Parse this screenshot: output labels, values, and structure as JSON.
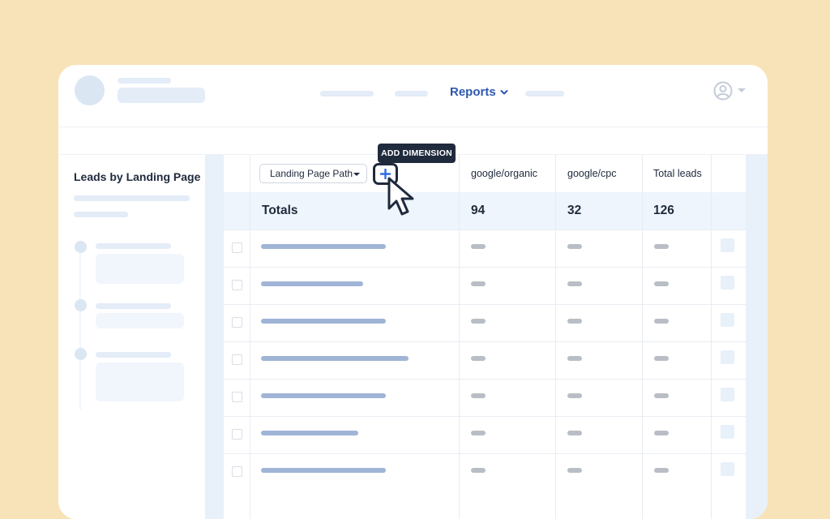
{
  "header": {
    "nav_active": "Reports"
  },
  "sidebar": {
    "title": "Leads by Landing Page"
  },
  "table": {
    "dimension_select": "Landing Page Path",
    "add_dimension_tooltip": "ADD DIMENSION",
    "columns": [
      "google/organic",
      "google/cpc",
      "Total leads"
    ],
    "totals_label": "Totals",
    "totals": [
      "94",
      "32",
      "126"
    ],
    "row_count": 7
  },
  "icons": {
    "nav_chevron": "chevron-down-icon",
    "user": "user-circle-icon",
    "add": "plus-icon",
    "pointer": "pointer-cursor-icon"
  },
  "colors": {
    "background": "#f8e3b8",
    "accent": "#2d58b0",
    "dark": "#1f2a3d"
  }
}
